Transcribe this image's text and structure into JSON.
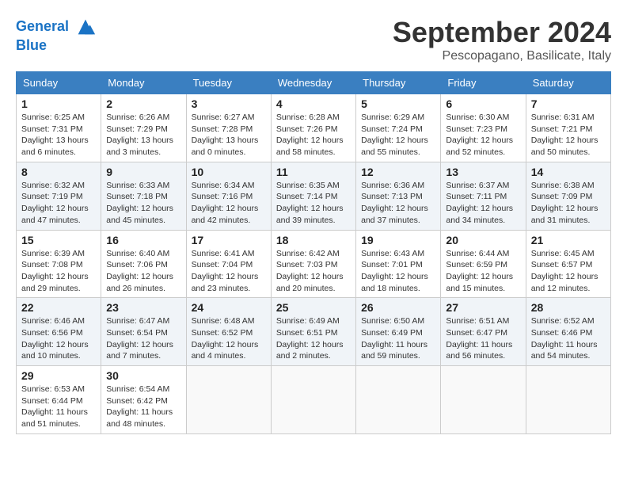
{
  "header": {
    "logo_line1": "General",
    "logo_line2": "Blue",
    "month_title": "September 2024",
    "location": "Pescopagano, Basilicate, Italy"
  },
  "weekdays": [
    "Sunday",
    "Monday",
    "Tuesday",
    "Wednesday",
    "Thursday",
    "Friday",
    "Saturday"
  ],
  "weeks": [
    [
      {
        "day": "1",
        "sunrise": "6:25 AM",
        "sunset": "7:31 PM",
        "daylight": "13 hours and 6 minutes."
      },
      {
        "day": "2",
        "sunrise": "6:26 AM",
        "sunset": "7:29 PM",
        "daylight": "13 hours and 3 minutes."
      },
      {
        "day": "3",
        "sunrise": "6:27 AM",
        "sunset": "7:28 PM",
        "daylight": "13 hours and 0 minutes."
      },
      {
        "day": "4",
        "sunrise": "6:28 AM",
        "sunset": "7:26 PM",
        "daylight": "12 hours and 58 minutes."
      },
      {
        "day": "5",
        "sunrise": "6:29 AM",
        "sunset": "7:24 PM",
        "daylight": "12 hours and 55 minutes."
      },
      {
        "day": "6",
        "sunrise": "6:30 AM",
        "sunset": "7:23 PM",
        "daylight": "12 hours and 52 minutes."
      },
      {
        "day": "7",
        "sunrise": "6:31 AM",
        "sunset": "7:21 PM",
        "daylight": "12 hours and 50 minutes."
      }
    ],
    [
      {
        "day": "8",
        "sunrise": "6:32 AM",
        "sunset": "7:19 PM",
        "daylight": "12 hours and 47 minutes."
      },
      {
        "day": "9",
        "sunrise": "6:33 AM",
        "sunset": "7:18 PM",
        "daylight": "12 hours and 45 minutes."
      },
      {
        "day": "10",
        "sunrise": "6:34 AM",
        "sunset": "7:16 PM",
        "daylight": "12 hours and 42 minutes."
      },
      {
        "day": "11",
        "sunrise": "6:35 AM",
        "sunset": "7:14 PM",
        "daylight": "12 hours and 39 minutes."
      },
      {
        "day": "12",
        "sunrise": "6:36 AM",
        "sunset": "7:13 PM",
        "daylight": "12 hours and 37 minutes."
      },
      {
        "day": "13",
        "sunrise": "6:37 AM",
        "sunset": "7:11 PM",
        "daylight": "12 hours and 34 minutes."
      },
      {
        "day": "14",
        "sunrise": "6:38 AM",
        "sunset": "7:09 PM",
        "daylight": "12 hours and 31 minutes."
      }
    ],
    [
      {
        "day": "15",
        "sunrise": "6:39 AM",
        "sunset": "7:08 PM",
        "daylight": "12 hours and 29 minutes."
      },
      {
        "day": "16",
        "sunrise": "6:40 AM",
        "sunset": "7:06 PM",
        "daylight": "12 hours and 26 minutes."
      },
      {
        "day": "17",
        "sunrise": "6:41 AM",
        "sunset": "7:04 PM",
        "daylight": "12 hours and 23 minutes."
      },
      {
        "day": "18",
        "sunrise": "6:42 AM",
        "sunset": "7:03 PM",
        "daylight": "12 hours and 20 minutes."
      },
      {
        "day": "19",
        "sunrise": "6:43 AM",
        "sunset": "7:01 PM",
        "daylight": "12 hours and 18 minutes."
      },
      {
        "day": "20",
        "sunrise": "6:44 AM",
        "sunset": "6:59 PM",
        "daylight": "12 hours and 15 minutes."
      },
      {
        "day": "21",
        "sunrise": "6:45 AM",
        "sunset": "6:57 PM",
        "daylight": "12 hours and 12 minutes."
      }
    ],
    [
      {
        "day": "22",
        "sunrise": "6:46 AM",
        "sunset": "6:56 PM",
        "daylight": "12 hours and 10 minutes."
      },
      {
        "day": "23",
        "sunrise": "6:47 AM",
        "sunset": "6:54 PM",
        "daylight": "12 hours and 7 minutes."
      },
      {
        "day": "24",
        "sunrise": "6:48 AM",
        "sunset": "6:52 PM",
        "daylight": "12 hours and 4 minutes."
      },
      {
        "day": "25",
        "sunrise": "6:49 AM",
        "sunset": "6:51 PM",
        "daylight": "12 hours and 2 minutes."
      },
      {
        "day": "26",
        "sunrise": "6:50 AM",
        "sunset": "6:49 PM",
        "daylight": "11 hours and 59 minutes."
      },
      {
        "day": "27",
        "sunrise": "6:51 AM",
        "sunset": "6:47 PM",
        "daylight": "11 hours and 56 minutes."
      },
      {
        "day": "28",
        "sunrise": "6:52 AM",
        "sunset": "6:46 PM",
        "daylight": "11 hours and 54 minutes."
      }
    ],
    [
      {
        "day": "29",
        "sunrise": "6:53 AM",
        "sunset": "6:44 PM",
        "daylight": "11 hours and 51 minutes."
      },
      {
        "day": "30",
        "sunrise": "6:54 AM",
        "sunset": "6:42 PM",
        "daylight": "11 hours and 48 minutes."
      },
      null,
      null,
      null,
      null,
      null
    ]
  ],
  "labels": {
    "sunrise": "Sunrise:",
    "sunset": "Sunset:",
    "daylight": "Daylight:"
  }
}
